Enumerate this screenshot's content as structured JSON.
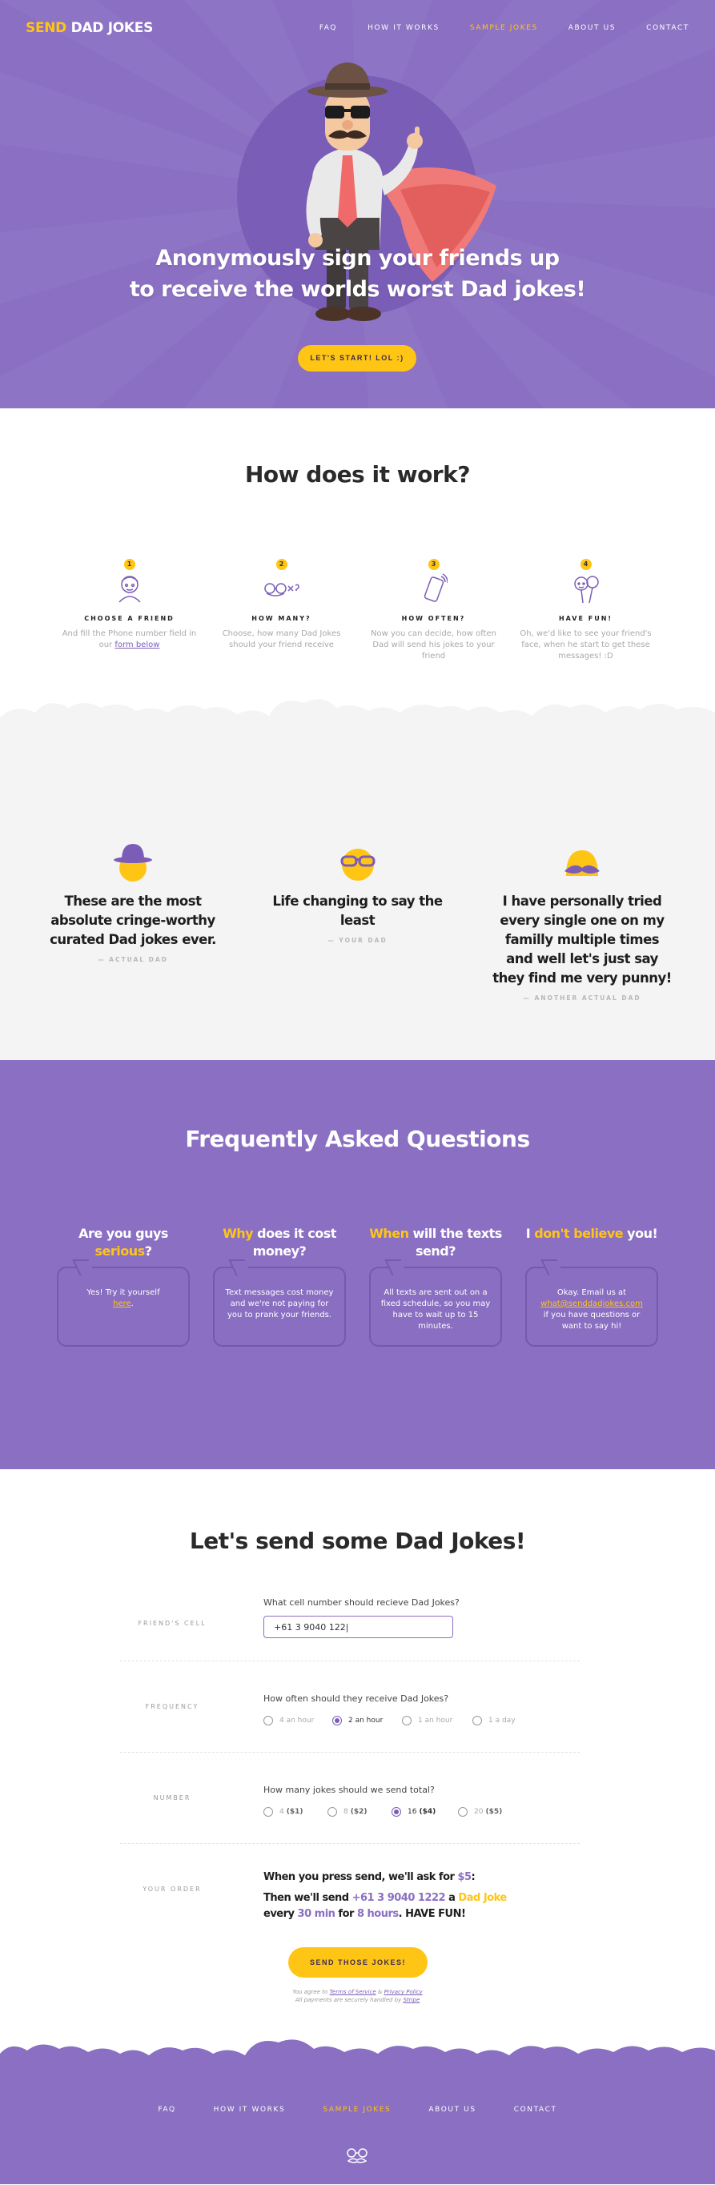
{
  "brand": {
    "first": "SEND",
    "second": "DAD JOKES"
  },
  "nav": [
    {
      "label": "FAQ",
      "active": false
    },
    {
      "label": "HOW IT WORKS",
      "active": false
    },
    {
      "label": "SAMPLE JOKES",
      "active": true
    },
    {
      "label": "ABOUT US",
      "active": false
    },
    {
      "label": "CONTACT",
      "active": false
    }
  ],
  "hero": {
    "line1": "Anonymously sign your friends up",
    "line2": "to receive the worlds worst Dad jokes!",
    "cta": "LET'S START! LOL :)"
  },
  "how": {
    "title": "How does it work?",
    "steps": [
      {
        "num": "1",
        "icon": "friend-face-icon",
        "title": "CHOOSE A FRIEND",
        "text_pre": "And fill the Phone number field in our ",
        "link": "form below",
        "text_post": ""
      },
      {
        "num": "2",
        "icon": "multiply-glasses-icon",
        "title": "HOW MANY?",
        "text_pre": "Choose, how many Dad Jokes should your friend receive",
        "link": "",
        "text_post": ""
      },
      {
        "num": "3",
        "icon": "phone-icon",
        "title": "HOW OFTEN?",
        "text_pre": "Now you can decide, how often Dad will send his jokes to your friend",
        "link": "",
        "text_post": ""
      },
      {
        "num": "4",
        "icon": "balloon-face-icon",
        "title": "HAVE FUN!",
        "text_pre": "Oh, we'd like to see your friend's face, when he start to get these messages! :D",
        "link": "",
        "text_post": ""
      }
    ]
  },
  "testimonials": [
    {
      "face": "hat-face-icon",
      "quote": "These are the most absolute cringe-worthy curated Dad jokes ever.",
      "by": "— ACTUAL DAD"
    },
    {
      "face": "glasses-face-icon",
      "quote": "Life changing to say the least",
      "by": "— YOUR DAD"
    },
    {
      "face": "mustache-face-icon",
      "quote": "I have personally tried every single one on my familly multiple times and well let's just say they find me very punny!",
      "by": "— ANOTHER ACTUAL DAD"
    }
  ],
  "faq": {
    "title": "Frequently Asked Questions",
    "items": [
      {
        "q_pre": "Are you guys ",
        "q_hl": "serious",
        "q_post": "?",
        "a_pre": "Yes! Try it yourself",
        "a_link": "here",
        "a_post": "."
      },
      {
        "q_pre": "",
        "q_hl": "Why",
        "q_post": " does it cost money?",
        "a_pre": "Text messages cost money and we're not paying for you to prank your friends.",
        "a_link": "",
        "a_post": ""
      },
      {
        "q_pre": "",
        "q_hl": "When",
        "q_post": " will the texts send?",
        "a_pre": "All texts are sent out on a fixed schedule, so you may have to wait up to 15 minutes.",
        "a_link": "",
        "a_post": ""
      },
      {
        "q_pre": "I ",
        "q_hl": "don't believe",
        "q_post": " you!",
        "a_pre": "Okay. Email us at",
        "a_link": "what@senddadjokes.com",
        "a_post": "if you have questions or want to say hi!"
      }
    ]
  },
  "form": {
    "title": "Let's send some Dad Jokes!",
    "cell": {
      "label": "FRIEND'S CELL",
      "question": "What cell number should recieve Dad Jokes?",
      "value": "+61 3 9040 122|"
    },
    "frequency": {
      "label": "FREQUENCY",
      "question": "How often should they receive Dad Jokes?",
      "options": [
        {
          "label": "4 an hour",
          "price": "",
          "selected": false
        },
        {
          "label": "2 an hour",
          "price": "",
          "selected": true
        },
        {
          "label": "1 an hour",
          "price": "",
          "selected": false
        },
        {
          "label": "1 a day",
          "price": "",
          "selected": false
        }
      ]
    },
    "number": {
      "label": "NUMBER",
      "question": "How many jokes should we send total?",
      "options": [
        {
          "label": "4",
          "price": "($1)",
          "selected": false
        },
        {
          "label": "8",
          "price": "($2)",
          "selected": false
        },
        {
          "label": "16",
          "price": "($4)",
          "selected": true
        },
        {
          "label": "20",
          "price": "($5)",
          "selected": false
        }
      ]
    },
    "order": {
      "label": "YOUR ORDER",
      "line1_pre": "When you press send, we'll ask for ",
      "line1_price": "$5",
      "line1_post": ":",
      "line2_pre": "Then we'll send ",
      "line2_phone": "+61 3 9040 1222",
      "line2_mid": " a ",
      "line2_hl": "Dad Joke",
      "line3_pre": "every ",
      "line3_a": "30 min",
      "line3_mid": " for ",
      "line3_b": "8 hours",
      "line3_post": ". HAVE FUN!"
    },
    "submit": "SEND THOSE JOKES!",
    "terms_pre": "You agree to ",
    "terms_link1": "Terms of Service",
    "terms_and": " & ",
    "terms_link2": "Privacy Policy",
    "pay_pre": "All payments are securely  handled by ",
    "pay_link": "Stripe"
  },
  "footer": [
    {
      "label": "FAQ",
      "active": false
    },
    {
      "label": "HOW IT WORKS",
      "active": false
    },
    {
      "label": "SAMPLE JOKES",
      "active": true
    },
    {
      "label": "ABOUT US",
      "active": false
    },
    {
      "label": "CONTACT",
      "active": false
    }
  ],
  "colors": {
    "purple": "#8a6fc2",
    "yellow": "#ffc515",
    "light_bg": "#f4f4f4"
  }
}
